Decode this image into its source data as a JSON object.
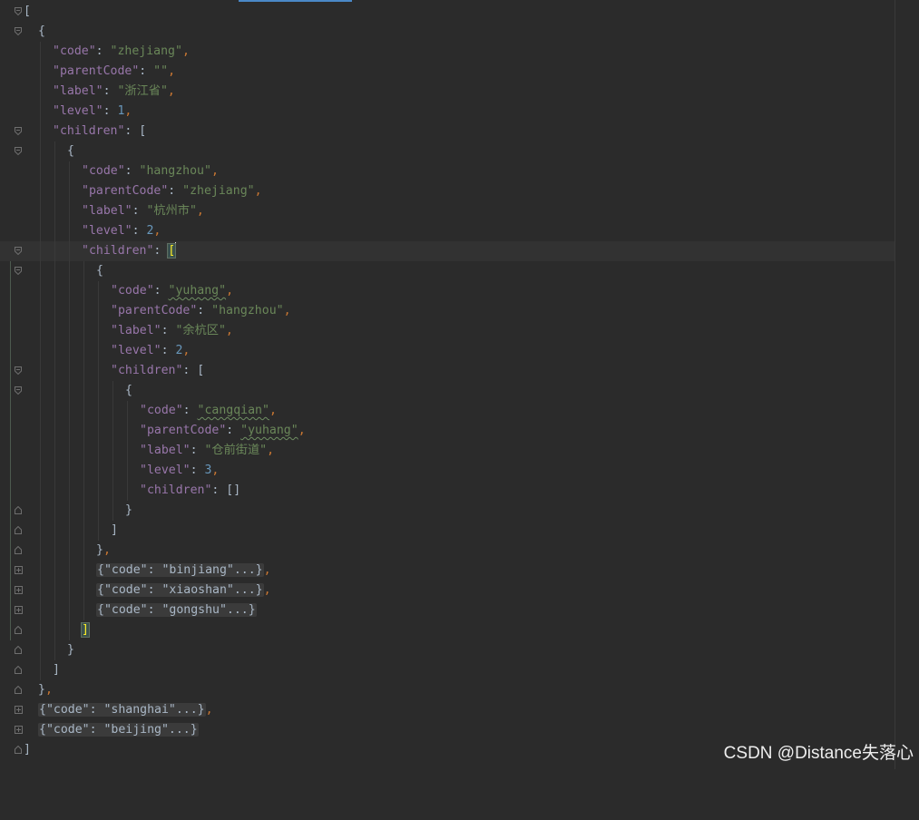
{
  "editor": {
    "watermark": "CSDN @Distance失落心",
    "json": {
      "open_bracket": "[",
      "close_bracket": "]",
      "root": {
        "code_key": "\"code\"",
        "code_val": "\"zhejiang\"",
        "parent_key": "\"parentCode\"",
        "parent_val": "\"\"",
        "label_key": "\"label\"",
        "label_val": "\"浙江省\"",
        "level_key": "\"level\"",
        "level_val": "1",
        "children_key": "\"children\""
      },
      "child": {
        "code_key": "\"code\"",
        "code_val": "\"hangzhou\"",
        "parent_key": "\"parentCode\"",
        "parent_val": "\"zhejiang\"",
        "label_key": "\"label\"",
        "label_val": "\"杭州市\"",
        "level_key": "\"level\"",
        "level_val": "2",
        "children_key": "\"children\""
      },
      "grandchild": {
        "code_key": "\"code\"",
        "code_val": "\"yuhang\"",
        "parent_key": "\"parentCode\"",
        "parent_val": "\"hangzhou\"",
        "label_key": "\"label\"",
        "label_val": "\"余杭区\"",
        "level_key": "\"level\"",
        "level_val": "2",
        "children_key": "\"children\""
      },
      "leaf": {
        "code_key": "\"code\"",
        "code_val": "\"cangqian\"",
        "parent_key": "\"parentCode\"",
        "parent_val": "\"yuhang\"",
        "label_key": "\"label\"",
        "label_val": "\"仓前街道\"",
        "level_key": "\"level\"",
        "level_val": "3",
        "children_key": "\"children\"",
        "children_val": "[]"
      },
      "folded": {
        "binjiang": "{\"code\": \"binjiang\"...}",
        "xiaoshan": "{\"code\": \"xiaoshan\"...}",
        "gongshu": "{\"code\": \"gongshu\"...}",
        "shanghai": "{\"code\": \"shanghai\"...}",
        "beijing": "{\"code\": \"beijing\"...}"
      }
    }
  }
}
